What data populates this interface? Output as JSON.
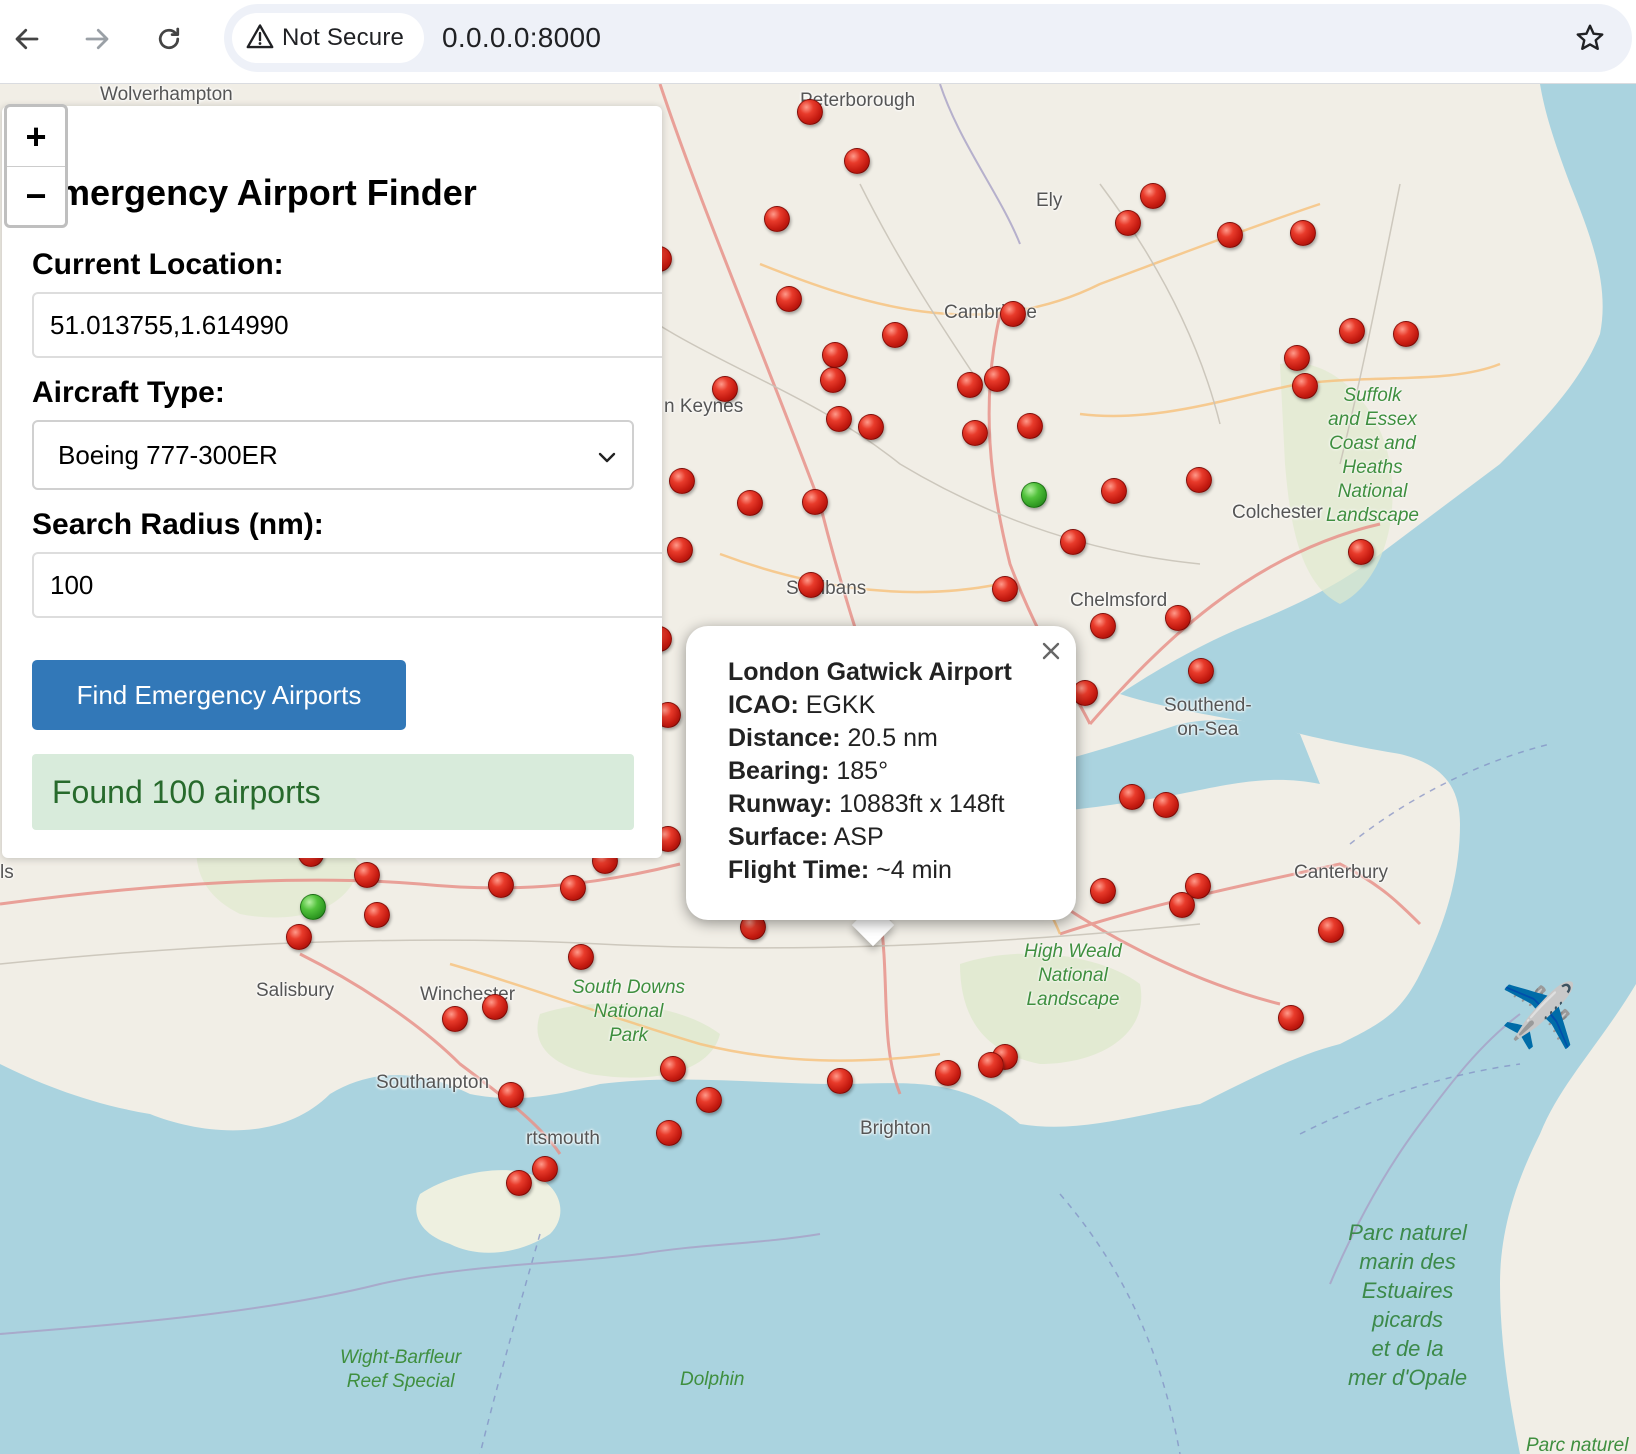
{
  "browser": {
    "security_label": "Not Secure",
    "url": "0.0.0.0:8000"
  },
  "map": {
    "zoom_in_label": "+",
    "zoom_out_label": "−",
    "places": [
      {
        "name": "Wolverhampton"
      },
      {
        "name": "Peterborough"
      },
      {
        "name": "Ely"
      },
      {
        "name": "Cambridge"
      },
      {
        "name": "n Keynes"
      },
      {
        "name": "St Albans"
      },
      {
        "name": "Chelmsford"
      },
      {
        "name": "Colchester"
      },
      {
        "name": "Southend-\non-Sea"
      },
      {
        "name": "Canterbury"
      },
      {
        "name": "Salisbury"
      },
      {
        "name": "Winchester"
      },
      {
        "name": "Southampton"
      },
      {
        "name": "rtsmouth"
      },
      {
        "name": "Brighton"
      },
      {
        "name": "ls"
      }
    ],
    "parks": [
      {
        "name": "Suffolk\nand Essex\nCoast and\nHeaths\nNational\nLandscape"
      },
      {
        "name": "High Weald\nNational\nLandscape"
      },
      {
        "name": "South Downs\nNational\nPark"
      },
      {
        "name": "Parc naturel\nmarin des\nEstuaires\npicards\net de la\nmer d'Opale"
      },
      {
        "name": "Wight-Barfleur\nReef Special"
      },
      {
        "name": "Dolphin"
      },
      {
        "name": "Parc naturel"
      }
    ],
    "aircraft_icon": "airplane-icon"
  },
  "panel": {
    "title": "Emergency Airport Finder",
    "location_label": "Current Location:",
    "location_value": "51.013755,1.614990",
    "aircraft_label": "Aircraft Type:",
    "aircraft_value": "Boeing 777-300ER",
    "radius_label": "Search Radius (nm):",
    "radius_value": "100",
    "find_button": "Find Emergency Airports",
    "status": "Found 100 airports"
  },
  "popup": {
    "name": "London Gatwick Airport",
    "icao_label": "ICAO:",
    "icao": "EGKK",
    "distance_label": "Distance:",
    "distance": "20.5 nm",
    "bearing_label": "Bearing:",
    "bearing": "185°",
    "runway_label": "Runway:",
    "runway": "10883ft x 148ft",
    "surface_label": "Surface:",
    "surface": "ASP",
    "flight_time_label": "Flight Time:",
    "flight_time": "~4 min"
  },
  "colors": {
    "button": "#3278b8",
    "status_bg": "#d8ebdb",
    "status_text": "#276a2c",
    "sea": "#aad3df",
    "land": "#f1eee6"
  }
}
